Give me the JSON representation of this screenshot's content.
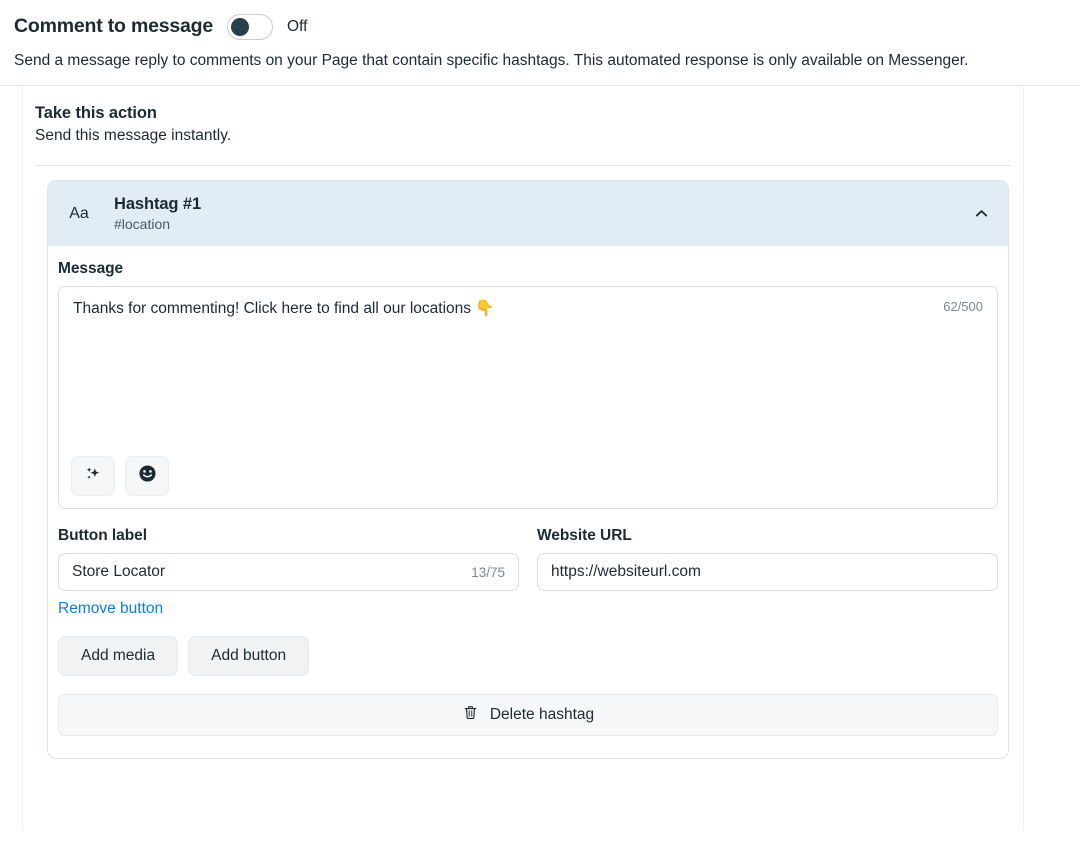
{
  "header": {
    "title": "Comment to message",
    "toggle_state": "Off",
    "toggle_on": false,
    "description": "Send a message reply to comments on your Page that contain specific hashtags. This automated response is only available on Messenger."
  },
  "action": {
    "title": "Take this action",
    "subtitle": "Send this message instantly."
  },
  "hashtag_card": {
    "icon_label": "Aa",
    "name": "Hashtag #1",
    "tag": "#location",
    "collapse_icon": "chevron-up-icon"
  },
  "message": {
    "label": "Message",
    "value": "Thanks for commenting! Click here to find all our locations 👇",
    "counter": "62/500",
    "tools": [
      {
        "name": "ai-sparkle-icon"
      },
      {
        "name": "emoji-icon"
      }
    ]
  },
  "button_label": {
    "label": "Button label",
    "value": "Store Locator",
    "counter": "13/75",
    "remove_link": "Remove button"
  },
  "website_url": {
    "label": "Website URL",
    "value": "https://websiteurl.com"
  },
  "actions": {
    "add_media": "Add media",
    "add_button": "Add button",
    "delete_hashtag": "Delete hashtag"
  },
  "colors": {
    "accent_link": "#0a7cff",
    "card_header_bg": "#e2ecf5",
    "text": "#1c2b33"
  }
}
